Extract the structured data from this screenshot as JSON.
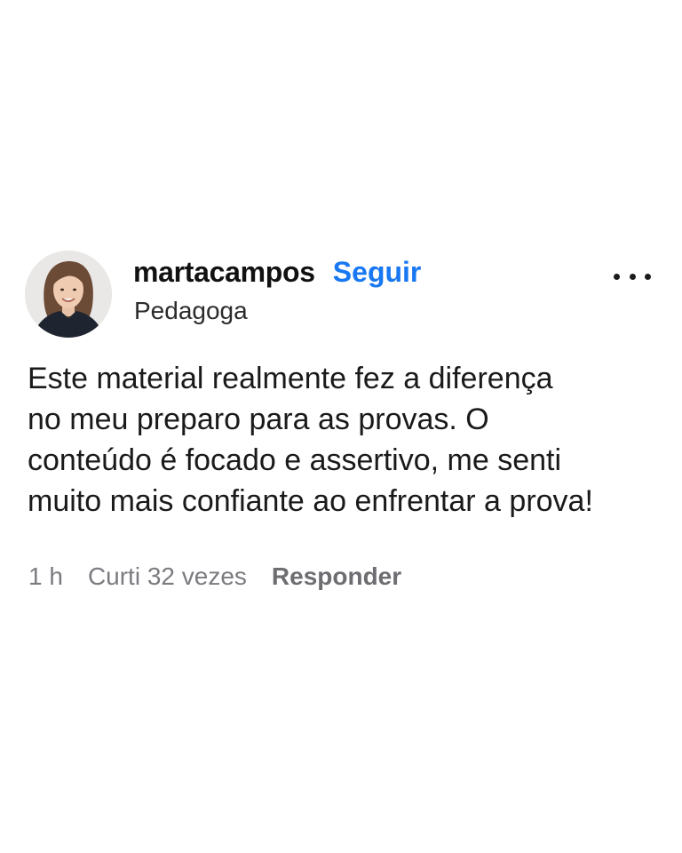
{
  "comment_card": {
    "author": {
      "username": "martacampos",
      "follow_label": "Seguir",
      "subtitle": "Pedagoga",
      "avatar_icon": "profile-photo"
    },
    "menu_icon": "more-horizontal-icon",
    "text_lines": [
      "Este material realmente fez a diferença",
      "no meu preparo para as provas. O",
      "conteúdo é focado e assertivo, me senti",
      "muito mais confiante ao enfrentar a prova!"
    ],
    "meta": {
      "time": "1 h",
      "likes": "Curti 32 vezes",
      "reply_label": "Responder"
    },
    "colors": {
      "follow": "#1877f2",
      "meta": "#7b7b80",
      "text": "#1a1a1a"
    }
  }
}
